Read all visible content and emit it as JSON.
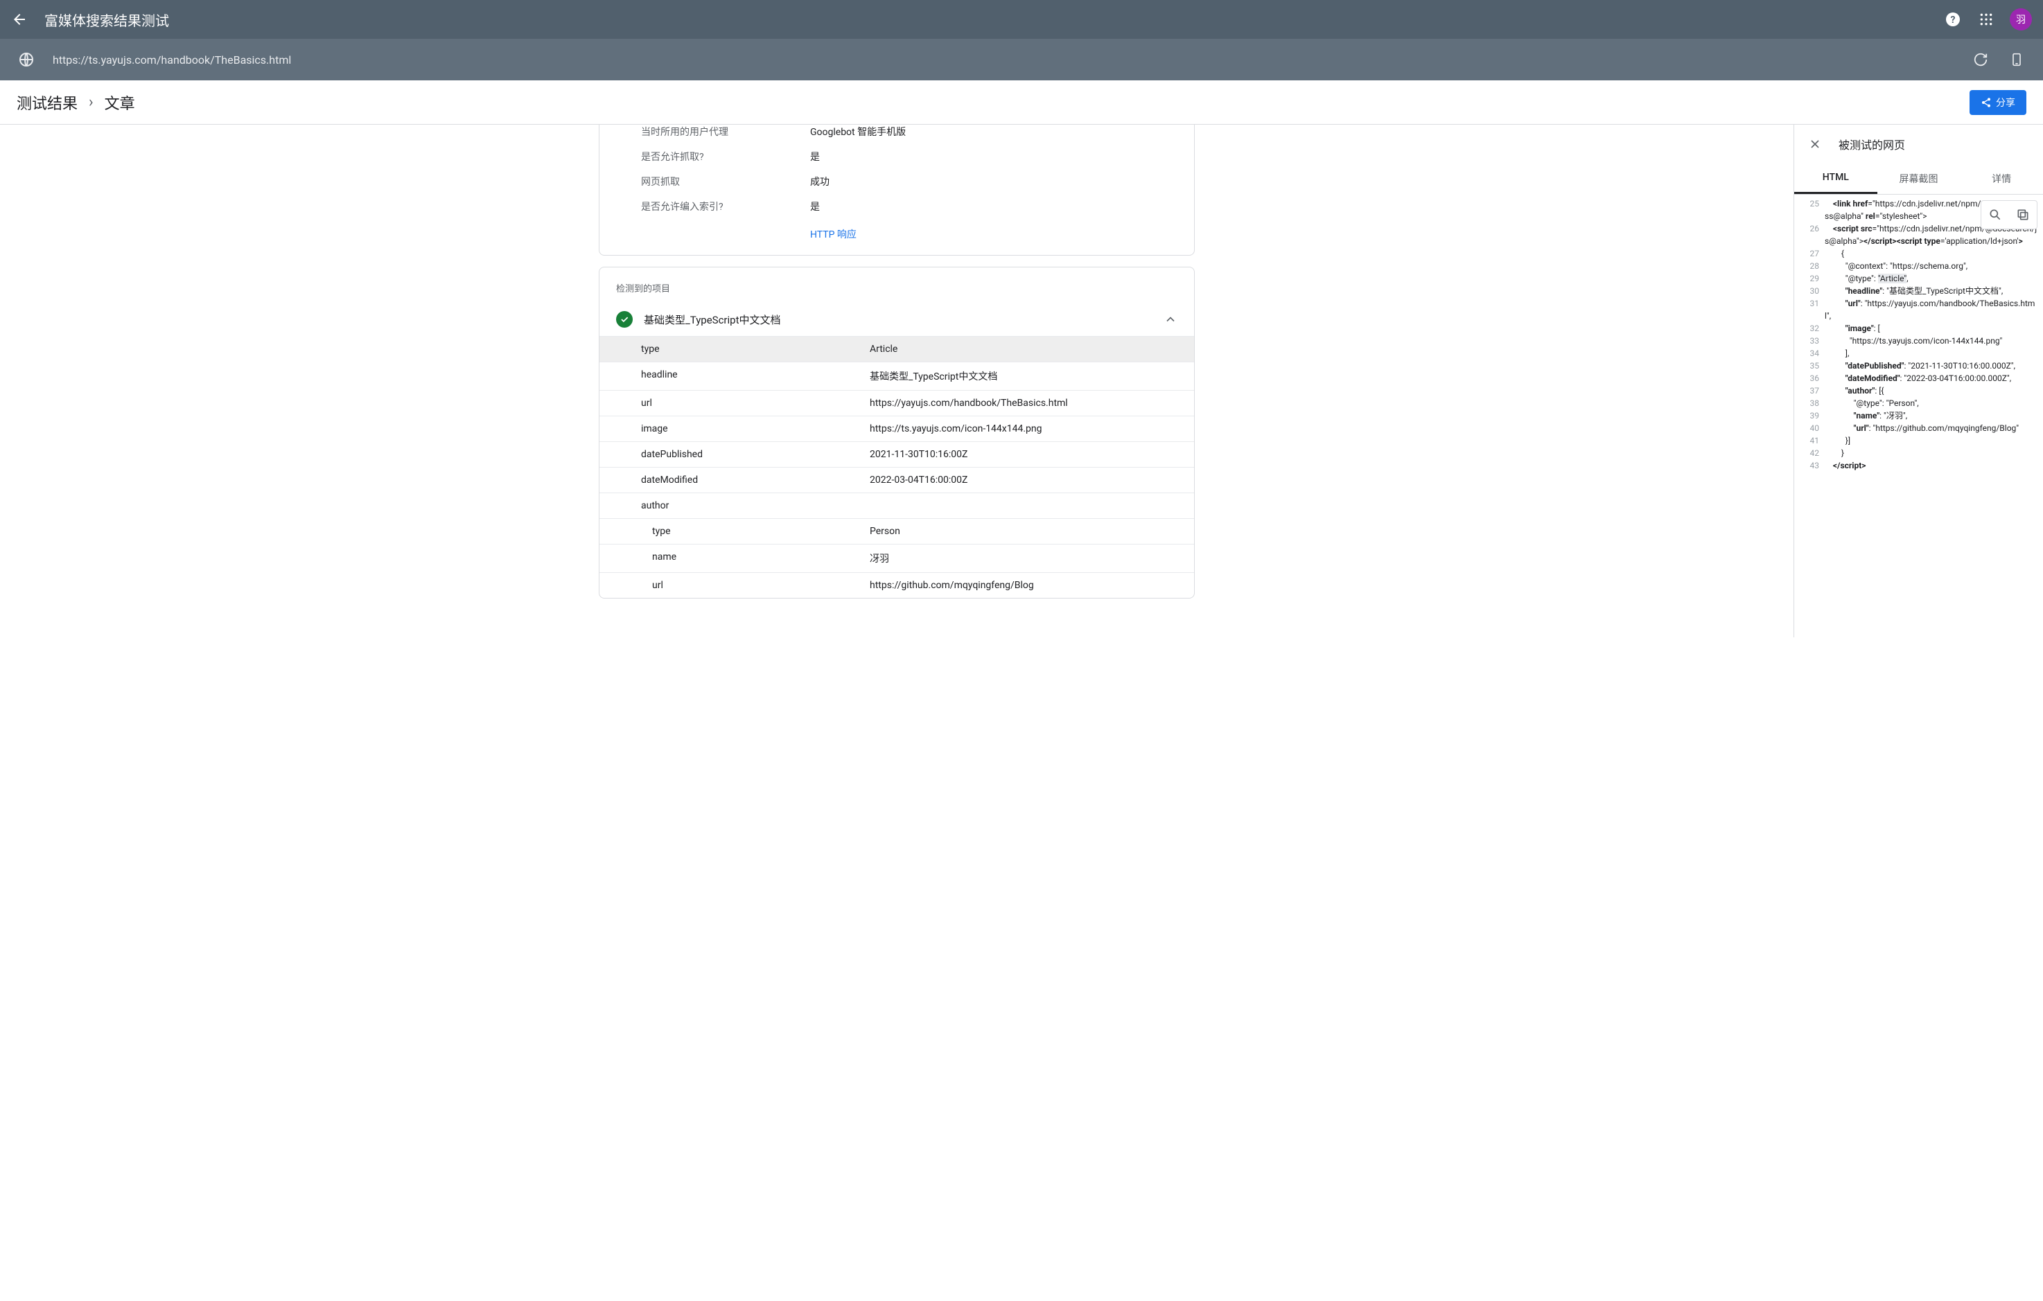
{
  "topbar": {
    "title": "富媒体搜索结果测试",
    "avatar": "羽"
  },
  "urlbar": {
    "url": "https://ts.yayujs.com/handbook/TheBasics.html"
  },
  "crumb": {
    "a": "测试结果",
    "b": "文章",
    "share": "分享"
  },
  "info": {
    "ua_label": "当时所用的用户代理",
    "ua_value": "Googlebot 智能手机版",
    "crawl_allowed_label": "是否允许抓取?",
    "crawl_allowed_value": "是",
    "fetch_label": "网页抓取",
    "fetch_value": "成功",
    "index_allowed_label": "是否允许编入索引?",
    "index_allowed_value": "是",
    "http_link": "HTTP 响应"
  },
  "detected": {
    "section": "检测到的项目",
    "name": "基础类型_TypeScript中文文档"
  },
  "fields": [
    {
      "k": "type",
      "v": "Article",
      "hl": true
    },
    {
      "k": "headline",
      "v": "基础类型_TypeScript中文文档"
    },
    {
      "k": "url",
      "v": "https://yayujs.com/handbook/TheBasics.html"
    },
    {
      "k": "image",
      "v": "https://ts.yayujs.com/icon-144x144.png"
    },
    {
      "k": "datePublished",
      "v": "2021-11-30T10:16:00Z"
    },
    {
      "k": "dateModified",
      "v": "2022-03-04T16:00:00Z"
    },
    {
      "k": "author",
      "v": ""
    },
    {
      "k": "type",
      "v": "Person",
      "indent": true
    },
    {
      "k": "name",
      "v": "冴羽",
      "indent": true
    },
    {
      "k": "url",
      "v": "https://github.com/mqyqingfeng/Blog",
      "indent": true
    }
  ],
  "sidepanel": {
    "title": "被测试的网页",
    "tabs": {
      "html": "HTML",
      "screenshot": "屏幕截图",
      "details": "详情"
    }
  },
  "code": [
    {
      "n": 25,
      "html": "    <b>&lt;link</b> <b>href</b>=\"https://cdn.jsdelivr.net/npm/@docsearch/css@alpha\" <b>rel</b>=\"stylesheet\"&gt;"
    },
    {
      "n": 26,
      "html": "    <b>&lt;script</b> <b>src</b>=\"https://cdn.jsdelivr.net/npm/@docsearch/js@alpha\"&gt;<b>&lt;/script&gt;&lt;script type</b>='application/ld+json'<b>&gt;</b>"
    },
    {
      "n": 27,
      "html": "        {"
    },
    {
      "n": 28,
      "html": "          \"@context\": \"https://schema.org\","
    },
    {
      "n": 29,
      "html": "          \"@type\": <span class='hl-span'>\"Article\"</span>,"
    },
    {
      "n": 30,
      "html": "          <b>\"headline\"</b>: \"基础类型_TypeScript中文文档\","
    },
    {
      "n": 31,
      "html": "          <b>\"url\"</b>: \"https://yayujs.com/handbook/TheBasics.html\","
    },
    {
      "n": 32,
      "html": "          <b>\"image\"</b>: ["
    },
    {
      "n": 33,
      "html": "            \"https://ts.yayujs.com/icon-144x144.png\""
    },
    {
      "n": 34,
      "html": "          ],"
    },
    {
      "n": 35,
      "html": "          <b>\"datePublished\"</b>: \"2021-11-30T10:16:00.000Z\","
    },
    {
      "n": 36,
      "html": "          <b>\"dateModified\"</b>: \"2022-03-04T16:00:00.000Z\","
    },
    {
      "n": 37,
      "html": "          <b>\"author\"</b>: [{"
    },
    {
      "n": 38,
      "html": "              \"@type\": \"Person\","
    },
    {
      "n": 39,
      "html": "              <b>\"name\"</b>: \"冴羽\","
    },
    {
      "n": 40,
      "html": "              <b>\"url\"</b>: \"https://github.com/mqyqingfeng/Blog\""
    },
    {
      "n": 41,
      "html": "          }]"
    },
    {
      "n": 42,
      "html": "        }"
    },
    {
      "n": 43,
      "html": "    <b>&lt;/script&gt;</b>"
    }
  ]
}
